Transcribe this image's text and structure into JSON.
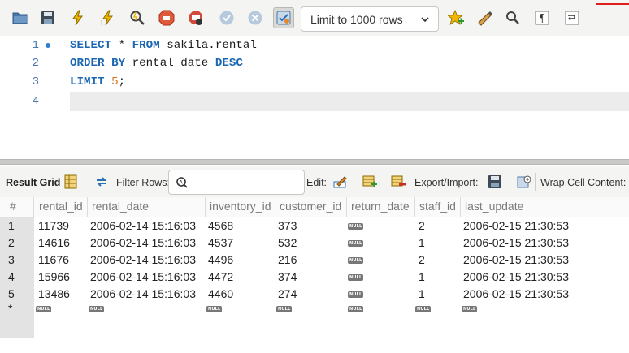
{
  "toolbar": {
    "limit_select": "Limit to 1000 rows",
    "icons": [
      "open-folder-icon",
      "save-icon",
      "execute-icon",
      "execute-current-icon",
      "explain-icon",
      "stop-icon",
      "toggle-continue-icon",
      "commit-icon",
      "rollback-icon",
      "autocommit-icon",
      "add-snippet-icon",
      "beautify-icon",
      "find-icon",
      "invisible-chars-icon",
      "wrap-icon"
    ]
  },
  "editor": {
    "lines": [
      {
        "num": "1",
        "kw1": "SELECT",
        "t1": " * ",
        "kw2": "FROM",
        "t2": " sakila.rental"
      },
      {
        "num": "2",
        "kw1": "ORDER BY",
        "t1": " rental_date ",
        "kw2": "DESC",
        "t2": ""
      },
      {
        "num": "3",
        "kw1": "LIMIT",
        "t1": " ",
        "n": "5",
        "t2": ";"
      },
      {
        "num": "4"
      }
    ]
  },
  "result_toolbar": {
    "result_grid": "Result Grid",
    "filter_rows": "Filter Rows:",
    "edit": "Edit:",
    "export_import": "Export/Import:",
    "wrap_cell": "Wrap Cell Content:"
  },
  "grid": {
    "columns": [
      "#",
      "rental_id",
      "rental_date",
      "inventory_id",
      "customer_id",
      "return_date",
      "staff_id",
      "last_update"
    ],
    "null_label": "NULL",
    "rows": [
      {
        "n": "1",
        "rental_id": "11739",
        "rental_date": "2006-02-14 15:16:03",
        "inventory_id": "4568",
        "customer_id": "373",
        "staff_id": "2",
        "last_update": "2006-02-15 21:30:53"
      },
      {
        "n": "2",
        "rental_id": "14616",
        "rental_date": "2006-02-14 15:16:03",
        "inventory_id": "4537",
        "customer_id": "532",
        "staff_id": "1",
        "last_update": "2006-02-15 21:30:53"
      },
      {
        "n": "3",
        "rental_id": "11676",
        "rental_date": "2006-02-14 15:16:03",
        "inventory_id": "4496",
        "customer_id": "216",
        "staff_id": "2",
        "last_update": "2006-02-15 21:30:53"
      },
      {
        "n": "4",
        "rental_id": "15966",
        "rental_date": "2006-02-14 15:16:03",
        "inventory_id": "4472",
        "customer_id": "374",
        "staff_id": "1",
        "last_update": "2006-02-15 21:30:53"
      },
      {
        "n": "5",
        "rental_id": "13486",
        "rental_date": "2006-02-14 15:16:03",
        "inventory_id": "4460",
        "customer_id": "274",
        "staff_id": "1",
        "last_update": "2006-02-15 21:30:53"
      }
    ],
    "new_row_marker": "*"
  }
}
